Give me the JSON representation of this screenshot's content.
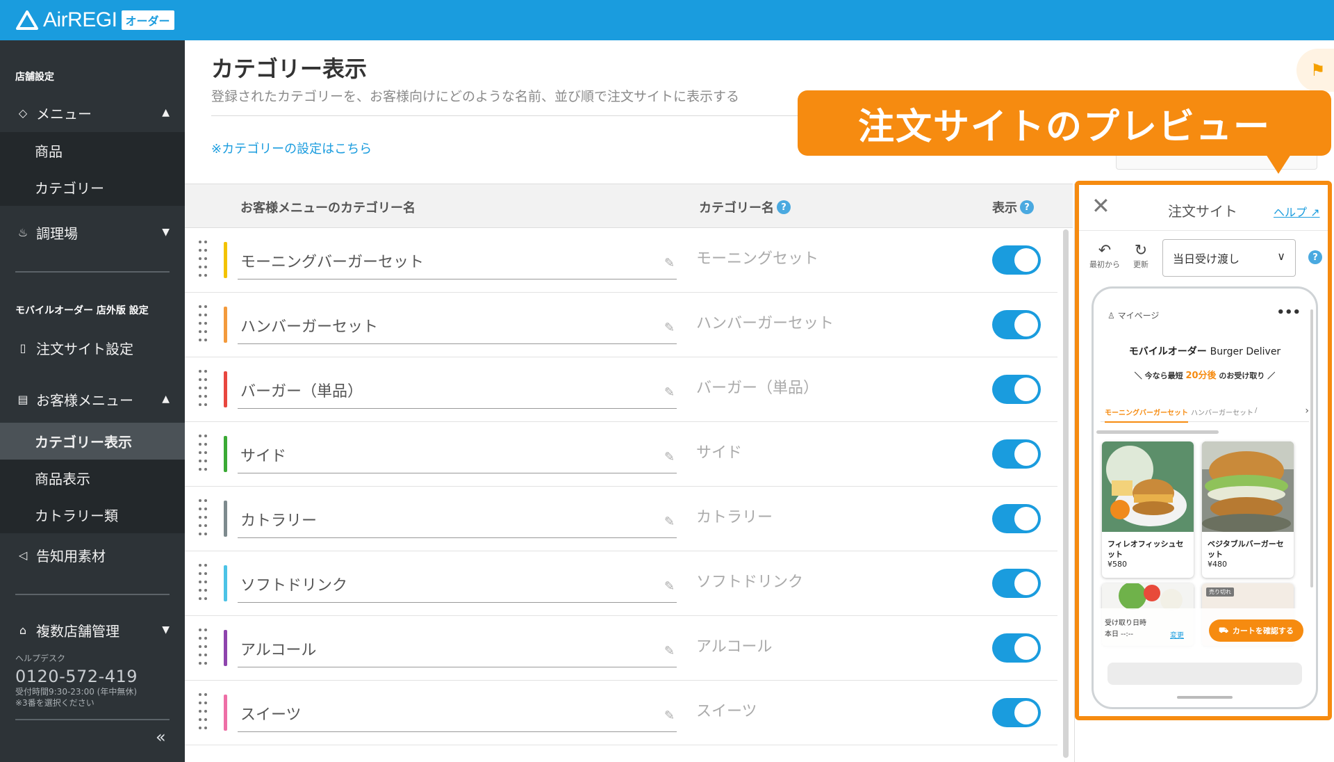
{
  "app": {
    "logo_text": "AirREGI",
    "logo_badge": "オーダー"
  },
  "sidebar": {
    "section_store": "店舗設定",
    "menu": {
      "label": "メニュー",
      "icon": "tag-icon"
    },
    "menu_sub": [
      "商品",
      "カテゴリー"
    ],
    "kitchen": {
      "label": "調理場",
      "icon": "chef-icon"
    },
    "section_mobile": "モバイルオーダー 店外版 設定",
    "order_site": {
      "label": "注文サイト設定",
      "icon": "smartphone-icon"
    },
    "customer_menu": {
      "label": "お客様メニュー",
      "icon": "clipboard-icon"
    },
    "customer_sub": [
      "カテゴリー表示",
      "商品表示",
      "カトラリー類"
    ],
    "promo": {
      "label": "告知用素材",
      "icon": "megaphone-icon"
    },
    "multi_store": {
      "label": "複数店舗管理",
      "icon": "store-icon"
    },
    "helpdesk": {
      "label": "ヘルプデスク",
      "phone": "0120-572-419",
      "hours": "受付時間9:30-23:00 (年中無休)",
      "note": "※3番を選択ください"
    },
    "collapse": "«"
  },
  "main": {
    "title": "カテゴリー表示",
    "description": "登録されたカテゴリーを、お客様向けにどのような名前、並び順で注文サイトに表示する",
    "settings_link": "※カテゴリーの設定はこちら",
    "columns": {
      "customer_name": "お客様メニューのカテゴリー名",
      "category_name": "カテゴリー名",
      "visible": "表示"
    },
    "rows": [
      {
        "customer_name": "モーニングバーガーセット",
        "category_name": "モーニングセット",
        "color": "#f3c300",
        "visible": true
      },
      {
        "customer_name": "ハンバーガーセット",
        "category_name": "ハンバーガーセット",
        "color": "#f39a3c",
        "visible": true
      },
      {
        "customer_name": "バーガー（単品）",
        "category_name": "バーガー（単品）",
        "color": "#e8473f",
        "visible": true
      },
      {
        "customer_name": "サイド",
        "category_name": "サイド",
        "color": "#3aaa35",
        "visible": true
      },
      {
        "customer_name": "カトラリー",
        "category_name": "カトラリー",
        "color": "#7d8a8e",
        "visible": true
      },
      {
        "customer_name": "ソフトドリンク",
        "category_name": "ソフトドリンク",
        "color": "#4cc3e6",
        "visible": true
      },
      {
        "customer_name": "アルコール",
        "category_name": "アルコール",
        "color": "#8e44ad",
        "visible": true
      },
      {
        "customer_name": "スイーツ",
        "category_name": "スイーツ",
        "color": "#ee6fa6",
        "visible": true
      }
    ]
  },
  "callout": {
    "text": "注文サイトのプレビュー"
  },
  "preview": {
    "title": "注文サイト",
    "help": "ヘルプ",
    "tool_reset": "最初から",
    "tool_refresh": "更新",
    "select_value": "当日受け渡し",
    "phone": {
      "mypage": "マイページ",
      "store_jp": "モバイルオーダー",
      "store_en": "Burger Deliver",
      "catch_pre": "＼ 今なら最短",
      "catch_highlight": "20分後",
      "catch_post": "のお受け取り ／",
      "tabs": [
        "モーニングバーガーセット",
        "ハンバーガーセット",
        "/"
      ],
      "items": [
        {
          "name": "フィレオフィッシュセット",
          "price": "¥580"
        },
        {
          "name": "ベジタブルバーガーセット",
          "price": "¥480"
        }
      ],
      "sold_out": "売り切れ",
      "pickup_label": "受け取り日時",
      "pickup_value": "本日 --:--",
      "pickup_change": "変更",
      "cart_button": "カートを確認する"
    }
  },
  "colors": {
    "brand": "#1a9cde",
    "accent": "#f68b10",
    "sidebar": "#2d3337"
  }
}
